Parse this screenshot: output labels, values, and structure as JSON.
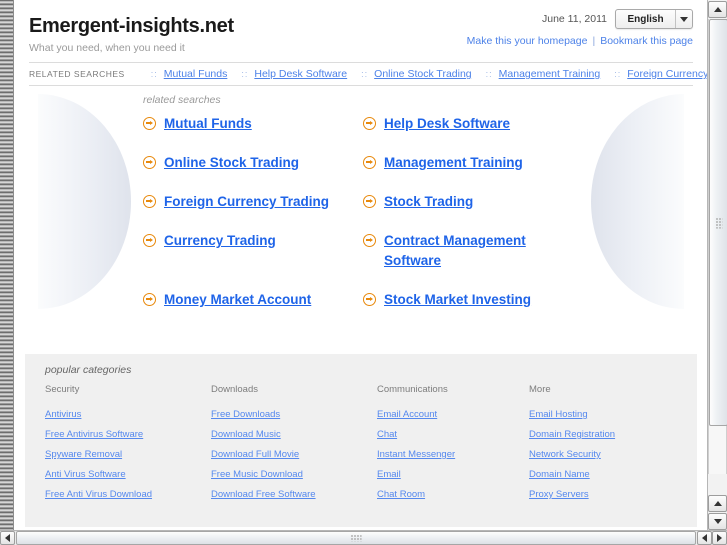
{
  "header": {
    "site_title": "Emergent-insights.net",
    "tagline": "What you need, when you need it",
    "date": "June 11, 2011",
    "language_selected": "English",
    "homepage_link": "Make this your homepage",
    "separator": "|",
    "bookmark_link": "Bookmark this page"
  },
  "related_strip": {
    "label": "RELATED SEARCHES",
    "dots": "::",
    "items": [
      {
        "label": "Mutual Funds"
      },
      {
        "label": "Help Desk Software"
      },
      {
        "label": "Online Stock Trading"
      },
      {
        "label": "Management Training"
      },
      {
        "label": "Foreign Currency Trading"
      }
    ]
  },
  "main": {
    "section_title": "related searches",
    "links": [
      {
        "label": "Mutual Funds"
      },
      {
        "label": "Help Desk Software"
      },
      {
        "label": "Online Stock Trading"
      },
      {
        "label": "Management Training"
      },
      {
        "label": "Foreign Currency Trading"
      },
      {
        "label": "Stock Trading"
      },
      {
        "label": "Currency Trading"
      },
      {
        "label": "Contract Management Software"
      },
      {
        "label": "Money Market Account"
      },
      {
        "label": "Stock Market Investing"
      }
    ]
  },
  "categories": {
    "title": "popular categories",
    "columns": [
      {
        "heading": "Security",
        "links": [
          {
            "label": "Antivirus"
          },
          {
            "label": "Free Antivirus Software"
          },
          {
            "label": "Spyware Removal"
          },
          {
            "label": "Anti Virus Software"
          },
          {
            "label": "Free Anti Virus Download"
          }
        ]
      },
      {
        "heading": "Downloads",
        "links": [
          {
            "label": "Free Downloads"
          },
          {
            "label": "Download Music"
          },
          {
            "label": "Download Full Movie"
          },
          {
            "label": "Free Music Download"
          },
          {
            "label": "Download Free Software"
          }
        ]
      },
      {
        "heading": "Communications",
        "links": [
          {
            "label": "Email Account"
          },
          {
            "label": "Chat"
          },
          {
            "label": "Instant Messenger"
          },
          {
            "label": "Email"
          },
          {
            "label": "Chat Room"
          }
        ]
      },
      {
        "heading": "More",
        "links": [
          {
            "label": "Email Hosting"
          },
          {
            "label": "Domain Registration"
          },
          {
            "label": "Network Security"
          },
          {
            "label": "Domain Name"
          },
          {
            "label": "Proxy Servers"
          }
        ]
      }
    ]
  },
  "colors": {
    "link_blue": "#1f64e8",
    "small_link_blue": "#5588ee",
    "bullet_orange": "#e8890c",
    "footer_bg": "#f0f0f0",
    "muted_gray": "#9a9a9a"
  }
}
